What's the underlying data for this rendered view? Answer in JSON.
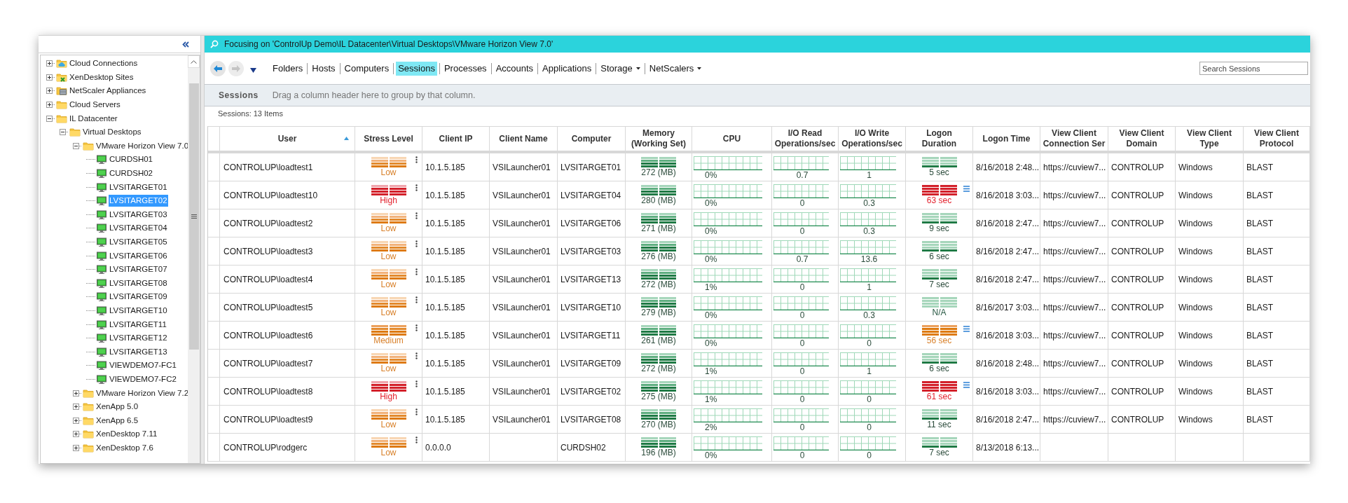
{
  "sidebar": {
    "tree": [
      {
        "label": "Cloud Connections",
        "kind": "cloud-folder",
        "expanded": false,
        "selected": false
      },
      {
        "label": "XenDesktop Sites",
        "kind": "sites-folder",
        "expanded": false,
        "selected": false
      },
      {
        "label": "NetScaler Appliances",
        "kind": "appliance-folder",
        "expanded": false,
        "selected": false
      },
      {
        "label": "Cloud Servers",
        "kind": "folder",
        "expanded": false,
        "selected": false
      },
      {
        "label": "IL Datacenter",
        "kind": "folder",
        "expanded": true,
        "selected": false,
        "children": [
          {
            "label": "Virtual Desktops",
            "kind": "folder",
            "expanded": true,
            "selected": false,
            "children": [
              {
                "label": "VMware Horizon View 7.0",
                "kind": "folder",
                "expanded": true,
                "selected": false,
                "children": [
                  {
                    "label": "CURDSH01",
                    "kind": "computer",
                    "selected": false
                  },
                  {
                    "label": "CURDSH02",
                    "kind": "computer",
                    "selected": false
                  },
                  {
                    "label": "LVSITARGET01",
                    "kind": "computer",
                    "selected": false
                  },
                  {
                    "label": "LVSITARGET02",
                    "kind": "computer",
                    "selected": true
                  },
                  {
                    "label": "LVSITARGET03",
                    "kind": "computer",
                    "selected": false
                  },
                  {
                    "label": "LVSITARGET04",
                    "kind": "computer",
                    "selected": false
                  },
                  {
                    "label": "LVSITARGET05",
                    "kind": "computer",
                    "selected": false
                  },
                  {
                    "label": "LVSITARGET06",
                    "kind": "computer",
                    "selected": false
                  },
                  {
                    "label": "LVSITARGET07",
                    "kind": "computer",
                    "selected": false
                  },
                  {
                    "label": "LVSITARGET08",
                    "kind": "computer",
                    "selected": false
                  },
                  {
                    "label": "LVSITARGET09",
                    "kind": "computer",
                    "selected": false
                  },
                  {
                    "label": "LVSITARGET10",
                    "kind": "computer",
                    "selected": false
                  },
                  {
                    "label": "LVSITARGET11",
                    "kind": "computer",
                    "selected": false
                  },
                  {
                    "label": "LVSITARGET12",
                    "kind": "computer",
                    "selected": false
                  },
                  {
                    "label": "LVSITARGET13",
                    "kind": "computer",
                    "selected": false
                  },
                  {
                    "label": "VIEWDEMO7-FC1",
                    "kind": "computer",
                    "selected": false
                  },
                  {
                    "label": "VIEWDEMO7-FC2",
                    "kind": "computer",
                    "selected": false
                  }
                ]
              },
              {
                "label": "VMware Horizon View 7.2",
                "kind": "folder",
                "expanded": false,
                "selected": false
              },
              {
                "label": "XenApp 5.0",
                "kind": "folder",
                "expanded": false,
                "selected": false
              },
              {
                "label": "XenApp 6.5",
                "kind": "folder",
                "expanded": false,
                "selected": false
              },
              {
                "label": "XenDesktop 7.11",
                "kind": "folder",
                "expanded": false,
                "selected": false
              },
              {
                "label": "XenDesktop 7.6",
                "kind": "folder",
                "expanded": false,
                "selected": false
              }
            ]
          }
        ]
      }
    ]
  },
  "focus_bar": {
    "text": "Focusing on 'ControlUp Demo\\IL Datacenter\\Virtual Desktops\\VMware Horizon View 7.0'"
  },
  "nav_tabs": [
    {
      "label": "Folders",
      "selected": false,
      "dropdown": false
    },
    {
      "label": "Hosts",
      "selected": false,
      "dropdown": false
    },
    {
      "label": "Computers",
      "selected": false,
      "dropdown": false
    },
    {
      "label": "Sessions",
      "selected": true,
      "dropdown": false
    },
    {
      "label": "Processes",
      "selected": false,
      "dropdown": false
    },
    {
      "label": "Accounts",
      "selected": false,
      "dropdown": false
    },
    {
      "label": "Applications",
      "selected": false,
      "dropdown": false
    },
    {
      "label": "Storage",
      "selected": false,
      "dropdown": true
    },
    {
      "label": "NetScalers",
      "selected": false,
      "dropdown": true
    }
  ],
  "search": {
    "placeholder": "Search Sessions"
  },
  "group_bar": {
    "title": "Sessions",
    "hint": "Drag a column header here to group by that column."
  },
  "item_count": "Sessions: 13 Items",
  "table": {
    "columns": [
      {
        "label": "User",
        "sorted": true
      },
      {
        "label": "Stress Level",
        "sorted": false
      },
      {
        "label": "Client IP",
        "sorted": false
      },
      {
        "label": "Client Name",
        "sorted": false
      },
      {
        "label": "Computer",
        "sorted": false
      },
      {
        "label": "Memory (Working Set)",
        "sorted": false
      },
      {
        "label": "CPU",
        "sorted": false
      },
      {
        "label": "I/O Read Operations/sec",
        "sorted": false
      },
      {
        "label": "I/O Write Operations/sec",
        "sorted": false
      },
      {
        "label": "Logon Duration",
        "sorted": false
      },
      {
        "label": "Logon Time",
        "sorted": false
      },
      {
        "label": "View Client Connection Ser",
        "sorted": false
      },
      {
        "label": "View Client Domain",
        "sorted": false
      },
      {
        "label": "View Client Type",
        "sorted": false
      },
      {
        "label": "View Client Protocol",
        "sorted": false
      }
    ],
    "rows": [
      {
        "user": "CONTROLUP\\loadtest1",
        "stress": {
          "kind": "low",
          "label": "Low"
        },
        "client_ip": "10.1.5.185",
        "client_name": "VSILauncher01",
        "computer": "LVSITARGET01",
        "memory": "272 (MB)",
        "cpu": "0%",
        "io_read": "0.7",
        "io_write": "1",
        "logon": {
          "kind": "normal",
          "label": "5 sec",
          "details": false
        },
        "logon_time": "8/16/2018 2:48...",
        "connection_server": "https://cuview7...",
        "domain": "CONTROLUP",
        "type": "Windows",
        "protocol": "BLAST"
      },
      {
        "user": "CONTROLUP\\loadtest10",
        "stress": {
          "kind": "high",
          "label": "High"
        },
        "client_ip": "10.1.5.185",
        "client_name": "VSILauncher01",
        "computer": "LVSITARGET04",
        "memory": "280 (MB)",
        "cpu": "0%",
        "io_read": "0",
        "io_write": "0.3",
        "logon": {
          "kind": "critical",
          "label": "63 sec",
          "details": true
        },
        "logon_time": "8/16/2018 3:03...",
        "connection_server": "https://cuview7...",
        "domain": "CONTROLUP",
        "type": "Windows",
        "protocol": "BLAST"
      },
      {
        "user": "CONTROLUP\\loadtest2",
        "stress": {
          "kind": "low",
          "label": "Low"
        },
        "client_ip": "10.1.5.185",
        "client_name": "VSILauncher01",
        "computer": "LVSITARGET06",
        "memory": "271 (MB)",
        "cpu": "0%",
        "io_read": "0",
        "io_write": "0.3",
        "logon": {
          "kind": "normal",
          "label": "9 sec",
          "details": false
        },
        "logon_time": "8/16/2018 2:47...",
        "connection_server": "https://cuview7...",
        "domain": "CONTROLUP",
        "type": "Windows",
        "protocol": "BLAST"
      },
      {
        "user": "CONTROLUP\\loadtest3",
        "stress": {
          "kind": "low",
          "label": "Low"
        },
        "client_ip": "10.1.5.185",
        "client_name": "VSILauncher01",
        "computer": "LVSITARGET03",
        "memory": "276 (MB)",
        "cpu": "0%",
        "io_read": "0.7",
        "io_write": "13.6",
        "logon": {
          "kind": "normal",
          "label": "6 sec",
          "details": false
        },
        "logon_time": "8/16/2018 2:47...",
        "connection_server": "https://cuview7...",
        "domain": "CONTROLUP",
        "type": "Windows",
        "protocol": "BLAST"
      },
      {
        "user": "CONTROLUP\\loadtest4",
        "stress": {
          "kind": "low",
          "label": "Low"
        },
        "client_ip": "10.1.5.185",
        "client_name": "VSILauncher01",
        "computer": "LVSITARGET13",
        "memory": "272 (MB)",
        "cpu": "1%",
        "io_read": "0",
        "io_write": "1",
        "logon": {
          "kind": "normal",
          "label": "7 sec",
          "details": false
        },
        "logon_time": "8/16/2018 2:47...",
        "connection_server": "https://cuview7...",
        "domain": "CONTROLUP",
        "type": "Windows",
        "protocol": "BLAST"
      },
      {
        "user": "CONTROLUP\\loadtest5",
        "stress": {
          "kind": "low",
          "label": "Low"
        },
        "client_ip": "10.1.5.185",
        "client_name": "VSILauncher01",
        "computer": "LVSITARGET10",
        "memory": "279 (MB)",
        "cpu": "0%",
        "io_read": "0",
        "io_write": "0.3",
        "logon": {
          "kind": "na",
          "label": "N/A",
          "details": false
        },
        "logon_time": "8/16/2017 3:03...",
        "connection_server": "https://cuview7...",
        "domain": "CONTROLUP",
        "type": "Windows",
        "protocol": "BLAST"
      },
      {
        "user": "CONTROLUP\\loadtest6",
        "stress": {
          "kind": "medium",
          "label": "Medium"
        },
        "client_ip": "10.1.5.185",
        "client_name": "VSILauncher01",
        "computer": "LVSITARGET11",
        "memory": "261 (MB)",
        "cpu": "0%",
        "io_read": "0",
        "io_write": "0",
        "logon": {
          "kind": "warning",
          "label": "56 sec",
          "details": true
        },
        "logon_time": "8/16/2018 3:03...",
        "connection_server": "https://cuview7...",
        "domain": "CONTROLUP",
        "type": "Windows",
        "protocol": "BLAST"
      },
      {
        "user": "CONTROLUP\\loadtest7",
        "stress": {
          "kind": "low",
          "label": "Low"
        },
        "client_ip": "10.1.5.185",
        "client_name": "VSILauncher01",
        "computer": "LVSITARGET09",
        "memory": "272 (MB)",
        "cpu": "1%",
        "io_read": "0",
        "io_write": "1",
        "logon": {
          "kind": "normal",
          "label": "6 sec",
          "details": false
        },
        "logon_time": "8/16/2018 2:48...",
        "connection_server": "https://cuview7...",
        "domain": "CONTROLUP",
        "type": "Windows",
        "protocol": "BLAST"
      },
      {
        "user": "CONTROLUP\\loadtest8",
        "stress": {
          "kind": "high",
          "label": "High"
        },
        "client_ip": "10.1.5.185",
        "client_name": "VSILauncher01",
        "computer": "LVSITARGET02",
        "memory": "275 (MB)",
        "cpu": "1%",
        "io_read": "0",
        "io_write": "0",
        "logon": {
          "kind": "critical",
          "label": "61 sec",
          "details": true
        },
        "logon_time": "8/16/2018 3:03...",
        "connection_server": "https://cuview7...",
        "domain": "CONTROLUP",
        "type": "Windows",
        "protocol": "BLAST"
      },
      {
        "user": "CONTROLUP\\loadtest9",
        "stress": {
          "kind": "low",
          "label": "Low"
        },
        "client_ip": "10.1.5.185",
        "client_name": "VSILauncher01",
        "computer": "LVSITARGET08",
        "memory": "270 (MB)",
        "cpu": "2%",
        "io_read": "0",
        "io_write": "0",
        "logon": {
          "kind": "normal",
          "label": "11 sec",
          "details": false
        },
        "logon_time": "8/16/2018 2:47...",
        "connection_server": "https://cuview7...",
        "domain": "CONTROLUP",
        "type": "Windows",
        "protocol": "BLAST"
      },
      {
        "user": "CONTROLUP\\rodgerc",
        "stress": {
          "kind": "low",
          "label": "Low"
        },
        "client_ip": "0.0.0.0",
        "computer": "CURDSH02",
        "memory": "196 (MB)",
        "cpu": "0%",
        "io_read": "0",
        "io_write": "0",
        "logon": {
          "kind": "normal",
          "label": "7 sec",
          "details": false
        },
        "logon_time": "8/13/2018 6:13..."
      }
    ]
  }
}
